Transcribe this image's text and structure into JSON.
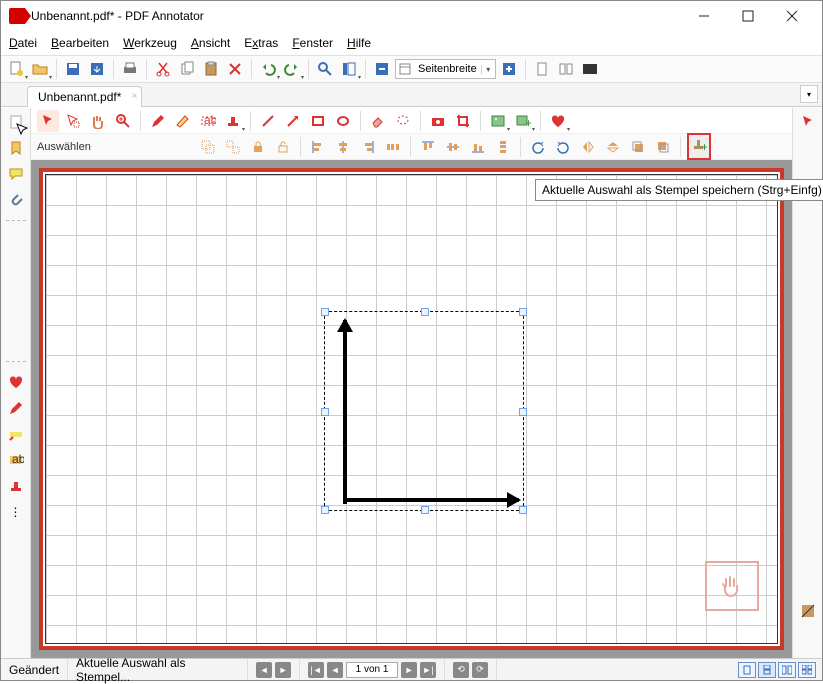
{
  "window": {
    "title": "Unbenannt.pdf* - PDF Annotator"
  },
  "menu": {
    "items": [
      "Datei",
      "Bearbeiten",
      "Werkzeug",
      "Ansicht",
      "Extras",
      "Fenster",
      "Hilfe"
    ]
  },
  "zoom": {
    "label": "Seitenbreite"
  },
  "tabs": {
    "active": "Unbenannt.pdf*"
  },
  "anno": {
    "mode_label": "Auswählen"
  },
  "tooltip": {
    "text": "Aktuelle Auswahl als Stempel speichern (Strg+Einfg)"
  },
  "status": {
    "modified": "Geändert",
    "hint": "Aktuelle Auswahl als Stempel...",
    "page": "1 von 1"
  },
  "colors": {
    "accent": "#c73a2a"
  }
}
